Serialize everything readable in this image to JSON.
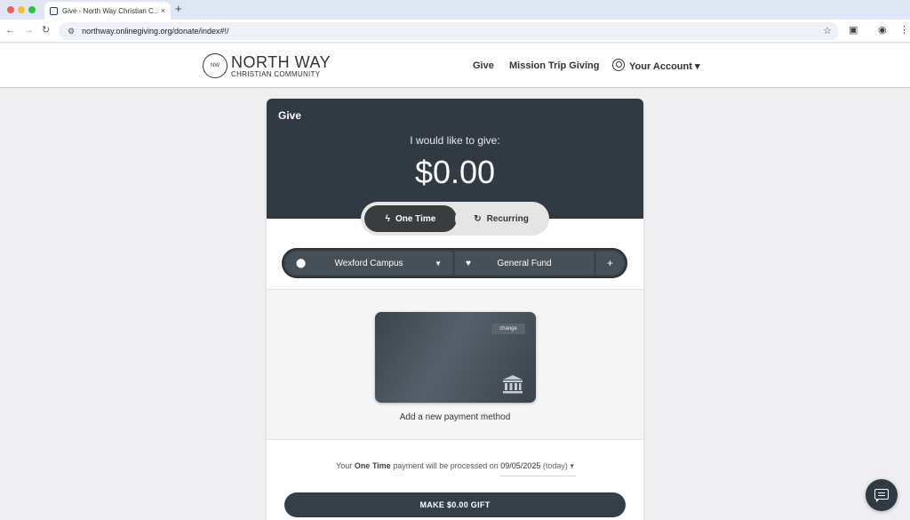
{
  "browser": {
    "tab_title": "Give - North Way Christian C...",
    "tab_close": "×",
    "new_tab": "+",
    "url": "northway.onlinegiving.org/donate/index#!/",
    "back": "←",
    "forward": "→",
    "reload": "↻",
    "site_info_icon": "⚙",
    "star": "☆"
  },
  "site": {
    "logo_mark": "NW",
    "logo_main": "NORTH WAY",
    "logo_sub": "CHRISTIAN COMMUNITY",
    "nav": {
      "give": "Give",
      "mission": "Mission Trip Giving",
      "account": "Your Account ▾"
    }
  },
  "give": {
    "title": "Give",
    "lead": "I would like to give:",
    "amount": "$0.00",
    "frequency": {
      "one_time": "One Time",
      "recurring": "Recurring",
      "selected": "One Time"
    },
    "campus": "Wexford Campus",
    "fund": "General Fund",
    "add": "+",
    "payment": {
      "change": "change",
      "label": "Add a new payment method"
    },
    "schedule": {
      "prefix": "Your",
      "freq": "One Time",
      "middle": "payment will be processed on",
      "date": "09/05/2025",
      "today": "(today) ▾"
    },
    "submit": "MAKE $0.00 GIFT"
  },
  "colors": {
    "header_dark": "#313a42",
    "toggle_active": "#3a3d40",
    "button": "#353f47"
  }
}
